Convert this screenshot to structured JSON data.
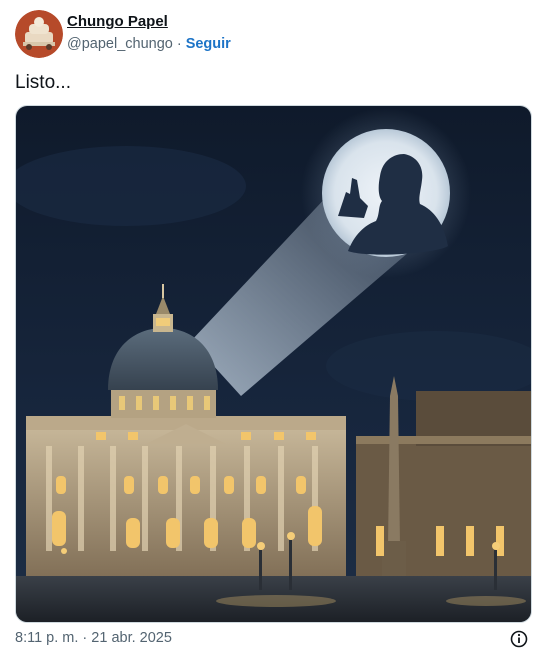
{
  "author": {
    "name": "Chungo Papel",
    "handle": "@papel_chungo",
    "separator": "·",
    "follow_label": "Seguir"
  },
  "tweet": {
    "text": "Listo..."
  },
  "meta": {
    "timestamp": "8:11 p. m. · 21 abr. 2025"
  },
  "icons": {
    "info": "info-icon"
  },
  "colors": {
    "accent": "#1d74c7",
    "secondary_text": "#536471",
    "primary_text": "#0f1419",
    "avatar_bg": "#b64a2a"
  }
}
